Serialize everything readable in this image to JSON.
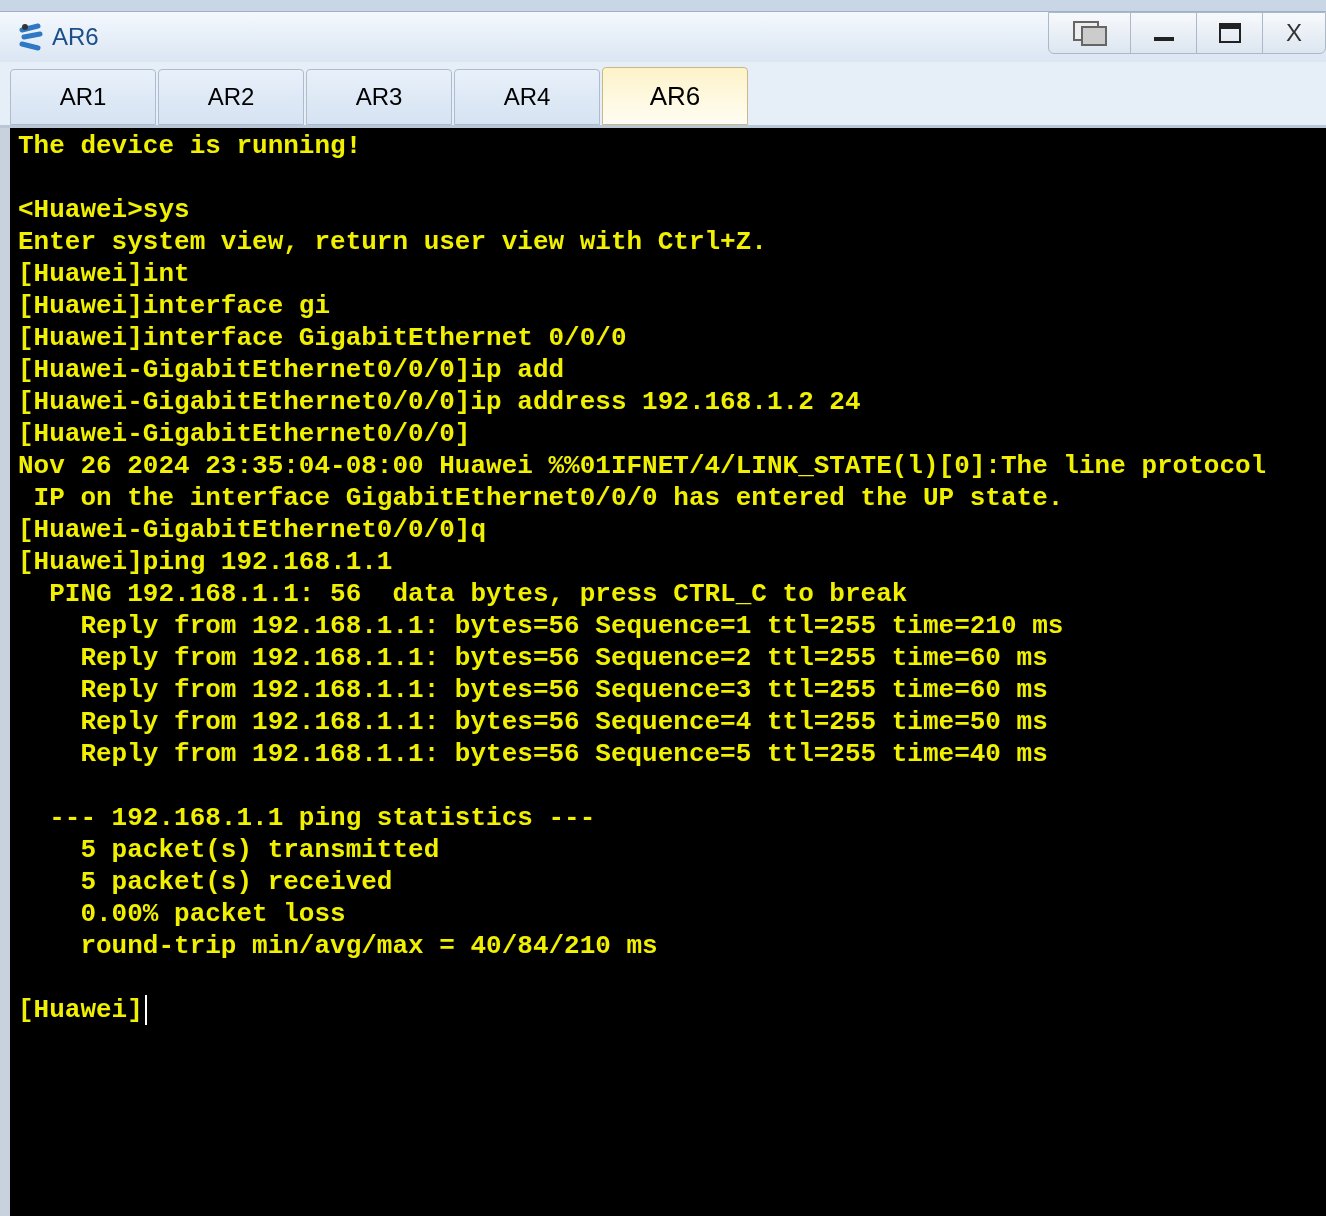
{
  "window": {
    "title": "AR6",
    "close_label": "X"
  },
  "tabs": [
    {
      "label": "AR1",
      "selected": false
    },
    {
      "label": "AR2",
      "selected": false
    },
    {
      "label": "AR3",
      "selected": false
    },
    {
      "label": "AR4",
      "selected": false
    },
    {
      "label": "AR6",
      "selected": true
    }
  ],
  "terminal": {
    "blocks": [
      [
        "The device is running!"
      ],
      [
        "<Huawei>sys",
        "Enter system view, return user view with Ctrl+Z.",
        "[Huawei]int",
        "[Huawei]interface gi",
        "[Huawei]interface GigabitEthernet 0/0/0",
        "[Huawei-GigabitEthernet0/0/0]ip add",
        "[Huawei-GigabitEthernet0/0/0]ip address 192.168.1.2 24",
        "[Huawei-GigabitEthernet0/0/0]",
        "Nov 26 2024 23:35:04-08:00 Huawei %%01IFNET/4/LINK_STATE(l)[0]:The line protocol",
        " IP on the interface GigabitEthernet0/0/0 has entered the UP state.",
        "[Huawei-GigabitEthernet0/0/0]q",
        "[Huawei]ping 192.168.1.1",
        "  PING 192.168.1.1: 56  data bytes, press CTRL_C to break",
        "    Reply from 192.168.1.1: bytes=56 Sequence=1 ttl=255 time=210 ms",
        "    Reply from 192.168.1.1: bytes=56 Sequence=2 ttl=255 time=60 ms",
        "    Reply from 192.168.1.1: bytes=56 Sequence=3 ttl=255 time=60 ms",
        "    Reply from 192.168.1.1: bytes=56 Sequence=4 ttl=255 time=50 ms",
        "    Reply from 192.168.1.1: bytes=56 Sequence=5 ttl=255 time=40 ms"
      ],
      [
        "  --- 192.168.1.1 ping statistics ---",
        "    5 packet(s) transmitted",
        "    5 packet(s) received",
        "    0.00% packet loss",
        "    round-trip min/avg/max = 40/84/210 ms"
      ],
      [
        "[Huawei]"
      ]
    ]
  }
}
